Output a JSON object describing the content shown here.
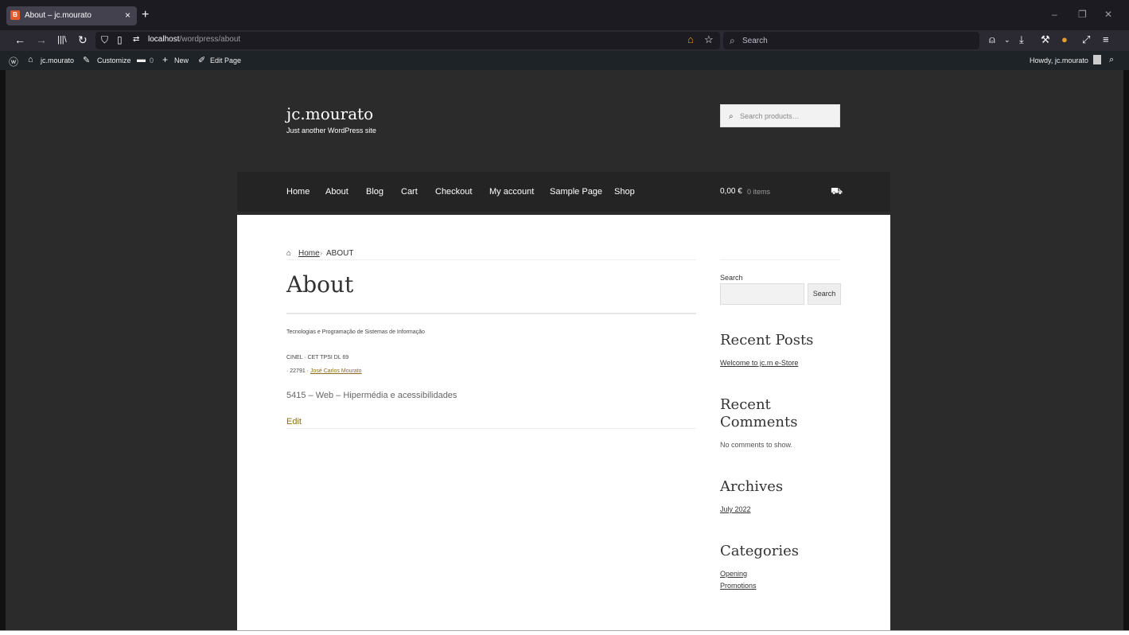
{
  "browser": {
    "tab_title": "About – jc.mourato",
    "tab_close": "×",
    "new_tab": "+",
    "favicon_text": "B",
    "url_host": "localhost",
    "url_path": "/wordpress/about",
    "search_placeholder": "Search",
    "window_controls": {
      "minimize": "–",
      "restore": "❐",
      "close": "✕"
    },
    "nav_icons": [
      "back-icon",
      "forward-icon",
      "library-icon",
      "reload-icon",
      "shield-icon",
      "page-icon",
      "permissions-icon"
    ]
  },
  "adminbar": {
    "wp_logo": "W",
    "site": "jc.mourato",
    "customize": "Customize",
    "comments_count": "0",
    "new": "New",
    "edit_page": "Edit Page",
    "howdy": "Howdy, jc.mourato"
  },
  "site": {
    "title": "jc.mourato",
    "tagline": "Just another WordPress site",
    "product_search_placeholder": "Search products…",
    "menu": [
      "Home",
      "About",
      "Blog",
      "Cart",
      "Checkout",
      "My account",
      "Sample Page",
      "Shop"
    ],
    "cart_total": "0,00 €",
    "cart_count": "0 items"
  },
  "breadcrumb": {
    "home": "Home",
    "sep": "›",
    "current": "ABOUT"
  },
  "page": {
    "title": "About",
    "line1": "Tecnologias e Programação de Sistemas de Informação",
    "line2": "CINEL · CET TPSI DL 69",
    "line3_prefix": "· 22791 · ",
    "line3_link": "José Carlos Mourato",
    "course": "5415 – Web – Hipermédia e acessibilidades",
    "edit": "Edit"
  },
  "sidebar": {
    "search_label": "Search",
    "search_button": "Search",
    "recent_posts_title": "Recent Posts",
    "recent_posts": [
      "Welcome to jc.m e-Store"
    ],
    "recent_comments_title": "Recent Comments",
    "no_comments": "No comments to show.",
    "archives_title": "Archives",
    "archives": [
      "July 2022"
    ],
    "categories_title": "Categories",
    "categories": [
      "Opening",
      "Promotions"
    ]
  }
}
